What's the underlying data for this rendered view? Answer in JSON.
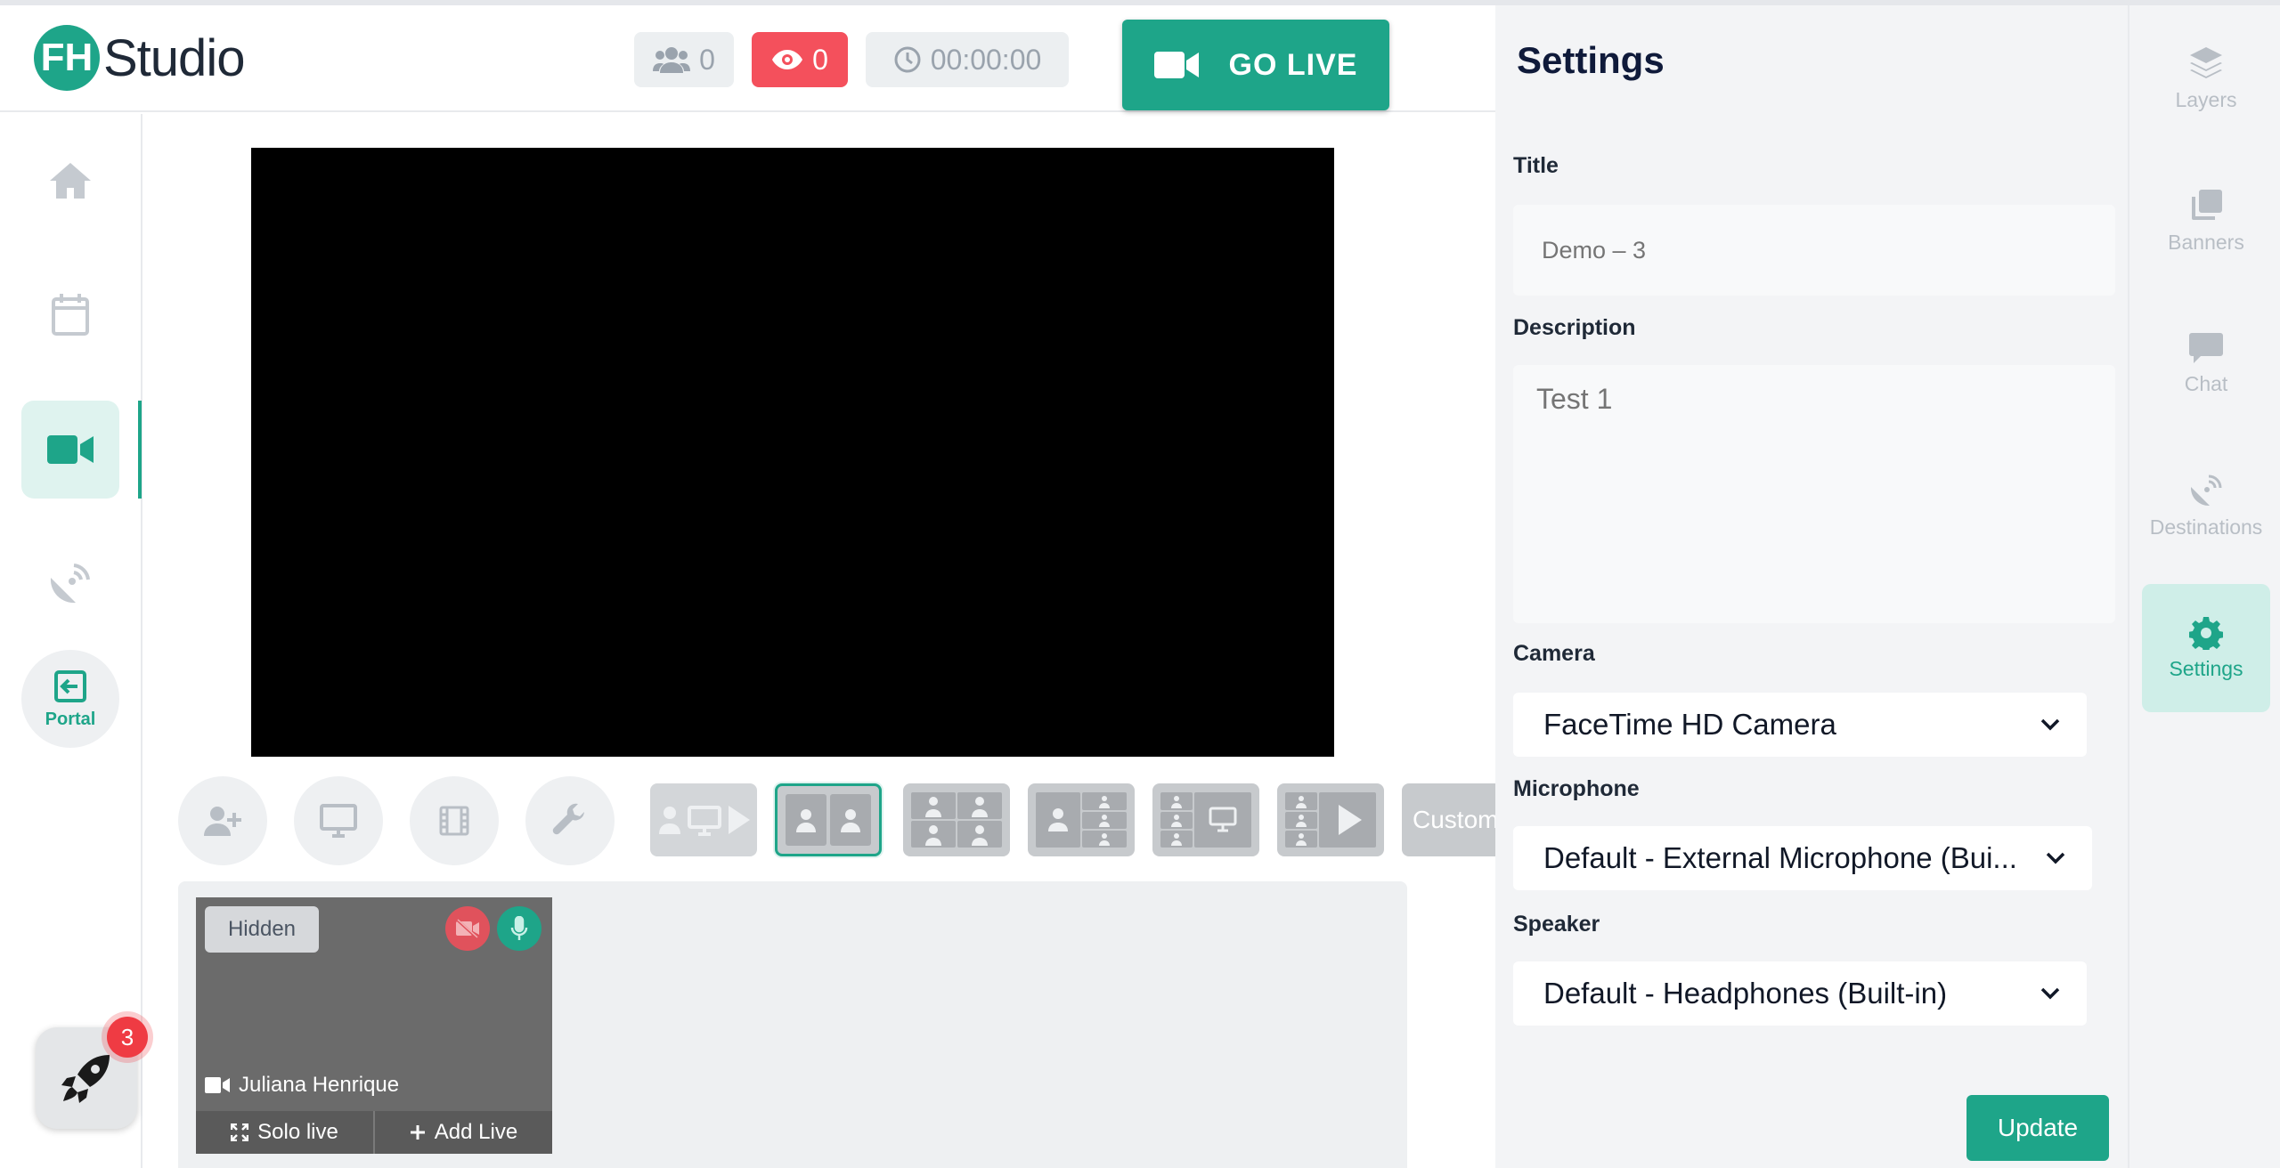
{
  "app": {
    "logo_letters": "FH",
    "logo_text": "Studio"
  },
  "header": {
    "viewers_count": "0",
    "live_viewers_count": "0",
    "timer": "00:00:00",
    "go_live_label": "GO LIVE"
  },
  "left_nav": {
    "items": [
      {
        "name": "home",
        "icon": "home-icon"
      },
      {
        "name": "calendar",
        "icon": "calendar-icon"
      },
      {
        "name": "studio",
        "icon": "video-camera-icon",
        "active": true
      },
      {
        "name": "broadcast",
        "icon": "satellite-dish-icon"
      }
    ],
    "portal_label": "Portal",
    "rocket_badge": "3"
  },
  "toolbar": {
    "custom_label": "Custom"
  },
  "participant": {
    "status_label": "Hidden",
    "name": "Juliana Henrique",
    "solo_label": "Solo live",
    "add_label": "Add Live"
  },
  "settings": {
    "title": "Settings",
    "title_label": "Title",
    "title_placeholder": "Demo – 3",
    "description_label": "Description",
    "description_placeholder": "Test 1",
    "camera_label": "Camera",
    "camera_value": "FaceTime HD Camera",
    "microphone_label": "Microphone",
    "microphone_value": "Default - External Microphone (Bui...",
    "speaker_label": "Speaker",
    "speaker_value": "Default - Headphones (Built-in)",
    "update_label": "Update"
  },
  "right_rail": {
    "items": [
      {
        "label": "Layers",
        "icon": "layers-icon"
      },
      {
        "label": "Banners",
        "icon": "banners-icon"
      },
      {
        "label": "Chat",
        "icon": "chat-icon"
      },
      {
        "label": "Destinations",
        "icon": "destinations-icon"
      },
      {
        "label": "Settings",
        "icon": "gear-icon",
        "active": true
      }
    ]
  },
  "colors": {
    "accent": "#1ea589",
    "danger": "#f4505c",
    "panel": "#f3f4f6"
  }
}
